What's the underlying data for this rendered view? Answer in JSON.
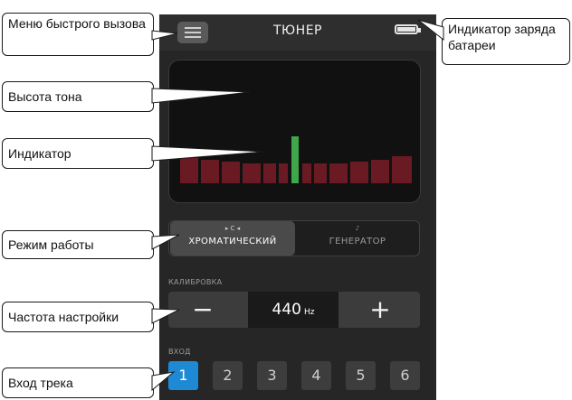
{
  "header": {
    "title": "ТЮНЕР"
  },
  "callouts": {
    "quick_menu": "Меню быстрого вызова",
    "pitch": "Высота тона",
    "indicator": "Индикатор",
    "mode": "Режим работы",
    "calib_freq": "Частота настройки",
    "track_input": "Вход трека",
    "battery": "Индикатор заряда батареи"
  },
  "mode": {
    "chromatic": {
      "icon_text": "▸ C ◂",
      "label": "ХРОМАТИЧЕСКИЙ",
      "selected": true
    },
    "generator": {
      "icon_text": "♪",
      "label": "ГЕНЕРАТОР",
      "selected": false
    }
  },
  "calibration": {
    "label": "КАЛИБРОВКА",
    "minus": "−",
    "value": "440",
    "unit": "Hz",
    "plus": "+"
  },
  "inputs": {
    "label": "ВХОД",
    "channels": [
      "1",
      "2",
      "3",
      "4",
      "5",
      "6"
    ],
    "selected": "1"
  },
  "colors": {
    "accent": "#1e8ad6",
    "needle": "#3fa64a",
    "segment": "#6a1a22"
  }
}
